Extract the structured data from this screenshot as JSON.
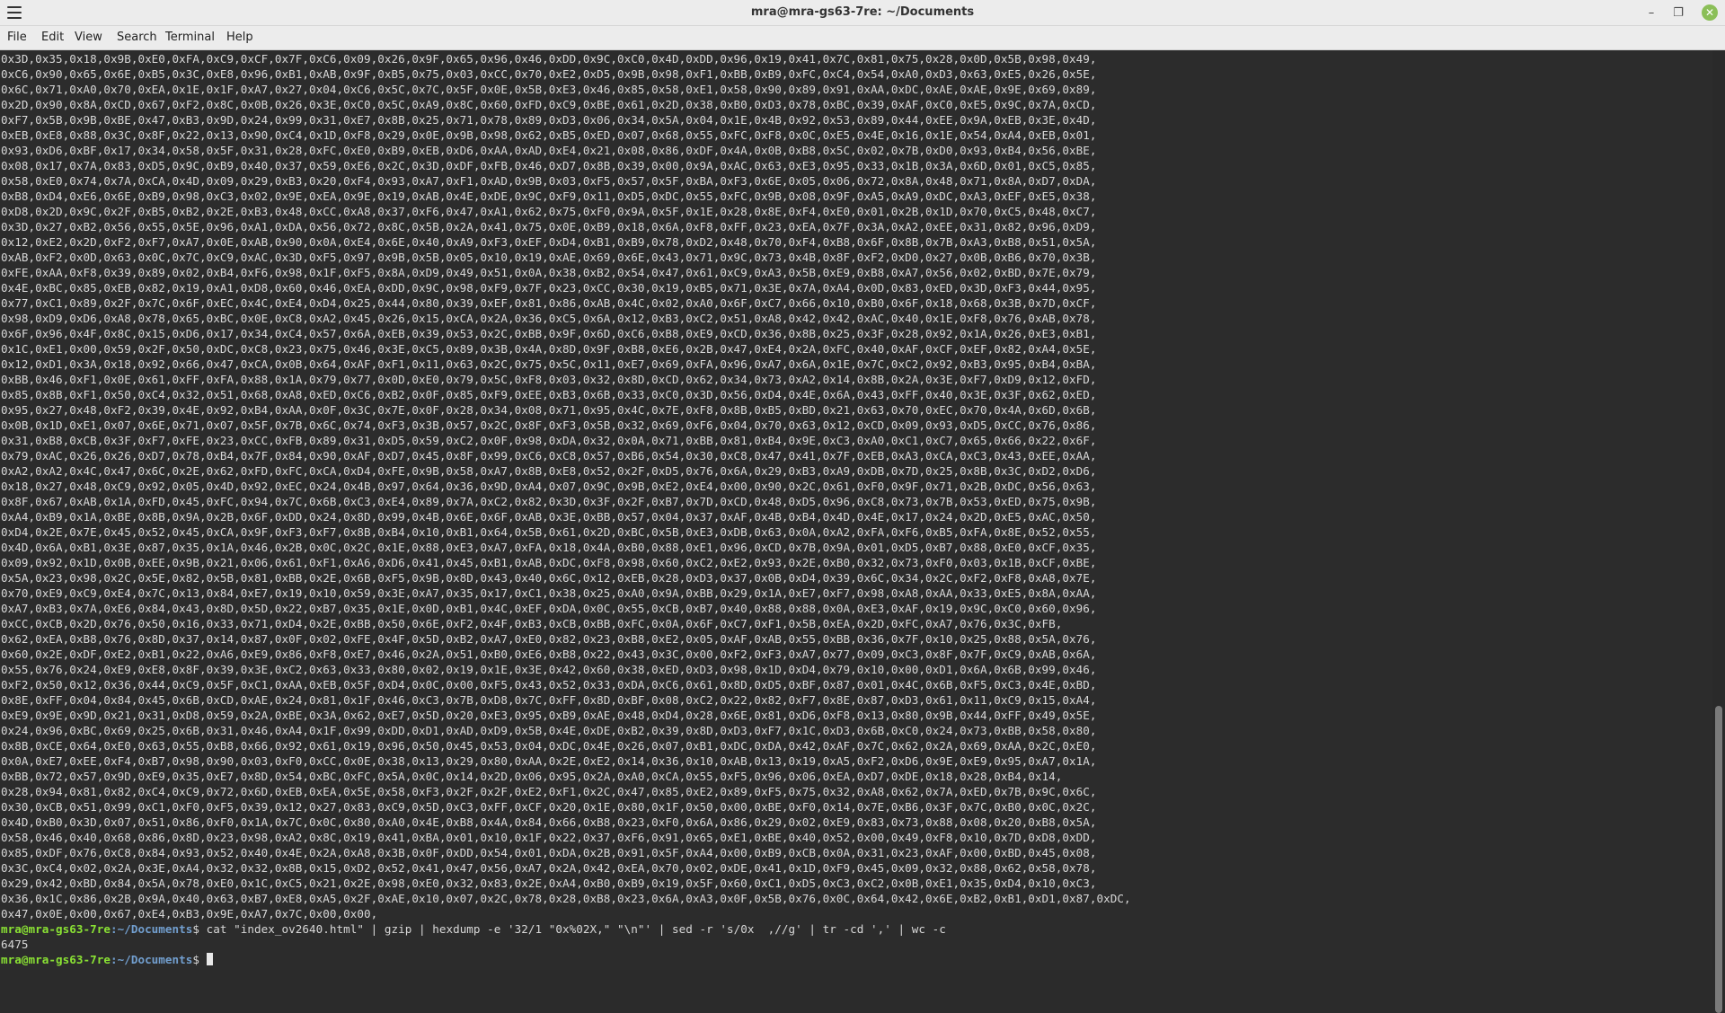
{
  "window": {
    "title": "mra@mra-gs63-7re: ~/Documents"
  },
  "menubar": {
    "file": "File",
    "edit": "Edit",
    "view": "View",
    "search": "Search",
    "terminal": "Terminal",
    "help": "Help"
  },
  "terminal": {
    "hex_lines": [
      "0x3D,0x35,0x18,0x9B,0xE0,0xFA,0xC9,0xCF,0x7F,0xC6,0x09,0x26,0x9F,0x65,0x96,0x46,0xDD,0x9C,0xC0,0x4D,0xDD,0x96,0x19,0x41,0x7C,0x81,0x75,0x28,0x0D,0x5B,0x98,0x49,",
      "0xC6,0x90,0x65,0x6E,0xB5,0x3C,0xE8,0x96,0xB1,0xAB,0x9F,0xB5,0x75,0x03,0xCC,0x70,0xE2,0xD5,0x9B,0x98,0xF1,0xBB,0xB9,0xFC,0xC4,0x54,0xA0,0xD3,0x63,0xE5,0x26,0x5E,",
      "0x6C,0x71,0xA0,0x70,0xEA,0x1E,0x1F,0xA7,0x27,0x04,0xC6,0x5C,0x7C,0x5F,0x0E,0x5B,0xE3,0x46,0x85,0x58,0xE1,0x58,0x90,0x89,0x91,0xAA,0xDC,0xAE,0xAE,0x9E,0x69,0x89,",
      "0x2D,0x90,0x8A,0xCD,0x67,0xF2,0x8C,0x0B,0x26,0x3E,0xC0,0x5C,0xA9,0x8C,0x60,0xFD,0xC9,0xBE,0x61,0x2D,0x38,0xB0,0xD3,0x78,0xBC,0x39,0xAF,0xC0,0xE5,0x9C,0x7A,0xCD,",
      "0xF7,0x5B,0x9B,0xBE,0x47,0xB3,0x9D,0x24,0x99,0x31,0xE7,0x8B,0x25,0x71,0x78,0x89,0xD3,0x06,0x34,0x5A,0x04,0x1E,0x4B,0x92,0x53,0x89,0x44,0xEE,0x9A,0xEB,0x3E,0x4D,",
      "0xEB,0xE8,0x88,0x3C,0x8F,0x22,0x13,0x90,0xC4,0x1D,0xF8,0x29,0x0E,0x9B,0x98,0x62,0xB5,0xED,0x07,0x68,0x55,0xFC,0xF8,0x0C,0xE5,0x4E,0x16,0x1E,0x54,0xA4,0xEB,0x01,",
      "0x93,0xD6,0xBF,0x17,0x34,0x58,0x5F,0x31,0x28,0xFC,0xE0,0xB9,0xEB,0xD6,0xAA,0xAD,0xE4,0x21,0x08,0x86,0xDF,0x4A,0x0B,0xB8,0x5C,0x02,0x7B,0xD0,0x93,0xB4,0x56,0xBE,",
      "0x08,0x17,0x7A,0x83,0xD5,0x9C,0xB9,0x40,0x37,0x59,0xE6,0x2C,0x3D,0xDF,0xFB,0x46,0xD7,0x8B,0x39,0x00,0x9A,0xAC,0x63,0xE3,0x95,0x33,0x1B,0x3A,0x6D,0x01,0xC5,0x85,",
      "0x58,0xE0,0x74,0x7A,0xCA,0x4D,0x09,0x29,0xB3,0x20,0xF4,0x93,0xA7,0xF1,0xAD,0x9B,0x03,0xF5,0x57,0x5F,0xBA,0xF3,0x6E,0x05,0x06,0x72,0x8A,0x48,0x71,0x8A,0xD7,0xDA,",
      "0xB8,0xD4,0xE6,0x6E,0xB9,0x98,0xC3,0x02,0x9E,0xEA,0x9E,0x19,0xAB,0x4E,0xDE,0x9C,0xF9,0x11,0xD5,0xDC,0x55,0xFC,0x9B,0x08,0x9F,0xA5,0xA9,0xDC,0xA3,0xEF,0xE5,0x38,",
      "0xD8,0x2D,0x9C,0x2F,0xB5,0xB2,0x2E,0xB3,0x48,0xCC,0xA8,0x37,0xF6,0x47,0xA1,0x62,0x75,0xF0,0x9A,0x5F,0x1E,0x28,0x8E,0xF4,0xE0,0x01,0x2B,0x1D,0x70,0xC5,0x48,0xC7,",
      "0x3D,0x27,0xB2,0x56,0x55,0x5E,0x96,0xA1,0xDA,0x56,0x72,0x8C,0x5B,0x2A,0x41,0x75,0x0E,0xB9,0x18,0x6A,0xF8,0xFF,0x23,0xEA,0x7F,0x3A,0xA2,0xEE,0x31,0x82,0x96,0xD9,",
      "0x12,0xE2,0x2D,0xF2,0xF7,0xA7,0x0E,0xAB,0x90,0x0A,0xE4,0x6E,0x40,0xA9,0xF3,0xEF,0xD4,0xB1,0xB9,0x78,0xD2,0x48,0x70,0xF4,0xB8,0x6F,0x8B,0x7B,0xA3,0xB8,0x51,0x5A,",
      "0xAB,0xF2,0x0D,0x63,0x0C,0x7C,0xC9,0xAC,0x3D,0xF5,0x97,0x9B,0x5B,0x05,0x10,0x19,0xAE,0x69,0x6E,0x43,0x71,0x9C,0x73,0x4B,0x8F,0xF2,0xD0,0x27,0x0B,0xB6,0x70,0x3B,",
      "0xFE,0xAA,0xF8,0x39,0x89,0x02,0xB4,0xF6,0x98,0x1F,0xF5,0x8A,0xD9,0x49,0x51,0x0A,0x38,0xB2,0x54,0x47,0x61,0xC9,0xA3,0x5B,0xE9,0xB8,0xA7,0x56,0x02,0xBD,0x7E,0x79,",
      "0x4E,0xBC,0x85,0xEB,0x82,0x19,0xA1,0xD8,0x60,0x46,0xEA,0xDD,0x9C,0x98,0xF9,0x7F,0x23,0xCC,0x30,0x19,0xB5,0x71,0x3E,0x7A,0xA4,0x0D,0x83,0xED,0x3D,0xF3,0x44,0x95,",
      "0x77,0xC1,0x89,0x2F,0x7C,0x6F,0xEC,0x4C,0xE4,0xD4,0x25,0x44,0x80,0x39,0xEF,0x81,0x86,0xAB,0x4C,0x02,0xA0,0x6F,0xC7,0x66,0x10,0xB0,0x6F,0x18,0x68,0x3B,0x7D,0xCF,",
      "0x98,0xD9,0xD6,0xA8,0x78,0x65,0xBC,0x0E,0xC8,0xA2,0x45,0x26,0x15,0xCA,0x2A,0x36,0xC5,0x6A,0x12,0xB3,0xC2,0x51,0xA8,0x42,0x42,0xAC,0x40,0x1E,0xF8,0x76,0xAB,0x78,",
      "0x6F,0x96,0x4F,0x8C,0x15,0xD6,0x17,0x34,0xC4,0x57,0x6A,0xEB,0x39,0x53,0x2C,0xBB,0x9F,0x6D,0xC6,0xB8,0xE9,0xCD,0x36,0x8B,0x25,0x3F,0x28,0x92,0x1A,0x26,0xE3,0xB1,",
      "0x1C,0xE1,0x00,0x59,0x2F,0x50,0xDC,0xC8,0x23,0x75,0x46,0x3E,0xC5,0x89,0x3B,0x4A,0x8D,0x9F,0xB8,0xE6,0x2B,0x47,0xE4,0x2A,0xFC,0x40,0xAF,0xCF,0xEF,0x82,0xA4,0x5E,",
      "0x12,0xD1,0x3A,0x18,0x92,0x66,0x47,0xCA,0x0B,0x64,0xAF,0xF1,0x11,0x63,0x2C,0x75,0x5C,0x11,0xE7,0x69,0xFA,0x96,0xA7,0x6A,0x1E,0x7C,0xC2,0x92,0xB3,0x95,0xB4,0xBA,",
      "0xBB,0x46,0xF1,0x0E,0x61,0xFF,0xFA,0x88,0x1A,0x79,0x77,0x0D,0xE0,0x79,0x5C,0xF8,0x03,0x32,0x8D,0xCD,0x62,0x34,0x73,0xA2,0x14,0x8B,0x2A,0x3E,0xF7,0xD9,0x12,0xFD,",
      "0x85,0x8B,0xF1,0x50,0xC4,0x32,0x51,0x68,0xA8,0xED,0xC6,0xB2,0x0F,0x85,0xF9,0xEE,0xB3,0x6B,0x33,0xC0,0x3D,0x56,0xD4,0x4E,0x6A,0x43,0xFF,0x40,0x3E,0x3F,0x62,0xED,",
      "0x95,0x27,0x48,0xF2,0x39,0x4E,0x92,0xB4,0xAA,0x0F,0x3C,0x7E,0x0F,0x28,0x34,0x08,0x71,0x95,0x4C,0x7E,0xF8,0x8B,0xB5,0xBD,0x21,0x63,0x70,0xEC,0x70,0x4A,0x6D,0x6B,",
      "0x0B,0x1D,0xE1,0x07,0x6E,0x71,0x07,0x5F,0x7B,0x6C,0x74,0xF3,0x3B,0x57,0x2C,0x8F,0xF3,0x5B,0x32,0x69,0xF6,0x04,0x70,0x63,0x12,0xCD,0x09,0x93,0xD5,0xCC,0x76,0x86,",
      "0x31,0xB8,0xCB,0x3F,0xF7,0xFE,0x23,0xCC,0xFB,0x89,0x31,0xD5,0x59,0xC2,0x0F,0x98,0xDA,0x32,0x0A,0x71,0xBB,0x81,0xB4,0x9E,0xC3,0xA0,0xC1,0xC7,0x65,0x66,0x22,0x6F,",
      "0x79,0xAC,0x26,0x26,0xD7,0x78,0xB4,0x7F,0x84,0x90,0xAF,0xD7,0x45,0x8F,0x99,0xC6,0xC8,0x57,0xB6,0x54,0x30,0xC8,0x47,0x41,0x7F,0xEB,0xA3,0xCA,0xC3,0x43,0xEE,0xAA,",
      "0xA2,0xA2,0x4C,0x47,0x6C,0x2E,0x62,0xFD,0xFC,0xCA,0xD4,0xFE,0x9B,0x58,0xA7,0x8B,0xE8,0x52,0x2F,0xD5,0x76,0x6A,0x29,0xB3,0xA9,0xDB,0x7D,0x25,0x8B,0x3C,0xD2,0xD6,",
      "0x18,0x27,0x48,0xC9,0x92,0x05,0x4D,0x92,0xEC,0x24,0x4B,0x97,0x64,0x36,0x9D,0xA4,0x07,0x9C,0x9B,0xE2,0xE4,0x00,0x90,0x2C,0x61,0xF0,0x9F,0x71,0x2B,0xDC,0x56,0x63,",
      "0x8F,0x67,0xAB,0x1A,0xFD,0x45,0xFC,0x94,0x7C,0x6B,0xC3,0xE4,0x89,0x7A,0xC2,0x82,0x3D,0x3F,0x2F,0xB7,0x7D,0xCD,0x48,0xD5,0x96,0xC8,0x73,0x7B,0x53,0xED,0x75,0x9B,",
      "0xA4,0xB9,0x1A,0xBE,0x8B,0x9A,0x2B,0x6F,0xDD,0x24,0x8D,0x99,0x4B,0x6E,0x6F,0xAB,0x3E,0xBB,0x57,0x04,0x37,0xAF,0x4B,0xB4,0x4D,0x4E,0x17,0x24,0x2D,0xE5,0xAC,0x50,",
      "0xD4,0x2E,0x7E,0x45,0x52,0x45,0xCA,0x9F,0xF3,0xF7,0x8B,0xB4,0x10,0xB1,0x64,0x5B,0x61,0x2D,0xBC,0x5B,0xE3,0xDB,0x63,0x0A,0xA2,0xFA,0xF6,0xB5,0xFA,0x8E,0x52,0x55,",
      "0x4D,0x6A,0xB1,0x3E,0x87,0x35,0x1A,0x46,0x2B,0x0C,0x2C,0x1E,0x88,0xE3,0xA7,0xFA,0x18,0x4A,0xB0,0x88,0xE1,0x96,0xCD,0x7B,0x9A,0x01,0xD5,0xB7,0x88,0xE0,0xCF,0x35,",
      "0x09,0x92,0x1D,0x0B,0xEE,0x9B,0x21,0x06,0x61,0xF1,0xA6,0xD6,0x41,0x45,0xB1,0xAB,0xDC,0xF8,0x98,0x60,0xC2,0xE2,0x93,0x2E,0xB0,0x32,0x73,0xF0,0x03,0x1B,0xCF,0xBE,",
      "0x5A,0x23,0x98,0x2C,0x5E,0x82,0x5B,0x81,0xBB,0x2E,0x6B,0xF5,0x9B,0x8D,0x43,0x40,0x6C,0x12,0xEB,0x28,0xD3,0x37,0x0B,0xD4,0x39,0x6C,0x34,0x2C,0xF2,0xF8,0xA8,0x7E,",
      "0x70,0xE9,0xC9,0xE4,0x7C,0x13,0x84,0xE7,0x19,0x10,0x59,0x3E,0xA7,0x35,0x17,0xC1,0x38,0x25,0xA0,0x9A,0xBB,0x29,0x1A,0xE7,0xF7,0x98,0xA8,0xAA,0x33,0xE5,0x8A,0xAA,",
      "0xA7,0xB3,0x7A,0xE6,0x84,0x43,0x8D,0x5D,0x22,0xB7,0x35,0x1E,0x0D,0xB1,0x4C,0xEF,0xDA,0x0C,0x55,0xCB,0xB7,0x40,0x88,0x88,0x0A,0xE3,0xAF,0x19,0x9C,0xC0,0x60,0x96,",
      "0xCC,0xCB,0x2D,0x76,0x50,0x16,0x33,0x71,0xD4,0x2E,0xBB,0x50,0x6E,0xF2,0x4F,0xB3,0xCB,0xBB,0xFC,0x0A,0x6F,0xC7,0xF1,0x5B,0xEA,0x2D,0xFC,0xA7,0x76,0x3C,0xFB,",
      "0x62,0xEA,0xB8,0x76,0x8D,0x37,0x14,0x87,0x0F,0x02,0xFE,0x4F,0x5D,0xB2,0xA7,0xE0,0x82,0x23,0xB8,0xE2,0x05,0xAF,0xAB,0x55,0xBB,0x36,0x7F,0x10,0x25,0x88,0x5A,0x76,",
      "0x60,0x2E,0xDF,0xE2,0xB1,0x22,0xA6,0xE9,0x86,0xF8,0xE7,0x46,0x2A,0x51,0xB0,0xE6,0xB8,0x22,0x43,0x3C,0x00,0xF2,0xF3,0xA7,0x77,0x09,0xC3,0x8F,0x7F,0xC9,0xAB,0x6A,",
      "0x55,0x76,0x24,0xE9,0xE8,0x8F,0x39,0x3E,0xC2,0x63,0x33,0x80,0x02,0x19,0x1E,0x3E,0x42,0x60,0x38,0xED,0xD3,0x98,0x1D,0xD4,0x79,0x10,0x00,0xD1,0x6A,0x6B,0x99,0x46,",
      "0xF2,0x50,0x12,0x36,0x44,0xC9,0x5F,0xC1,0xAA,0xEB,0x5F,0xD4,0x0C,0x00,0xF5,0x43,0x52,0x33,0xDA,0xC6,0x61,0x8D,0xD5,0xBF,0x87,0x01,0x4C,0x6B,0xF5,0xC3,0x4E,0xBD,",
      "0x8E,0xFF,0x04,0x84,0x45,0x6B,0xCD,0xAE,0x24,0x81,0x1F,0x46,0xC3,0x7B,0xD8,0x7C,0xFF,0x8D,0xBF,0x08,0xC2,0x22,0x82,0xF7,0x8E,0x87,0xD3,0x61,0x11,0xC9,0x15,0xA4,",
      "0xE9,0x9E,0x9D,0x21,0x31,0xD8,0x59,0x2A,0xBE,0x3A,0x62,0xE7,0x5D,0x20,0xE3,0x95,0xB9,0xAE,0x48,0xD4,0x28,0x6E,0x81,0xD6,0xF8,0x13,0x80,0x9B,0x44,0xFF,0x49,0x5E,",
      "0x24,0x96,0xBC,0x69,0x25,0x6B,0x31,0x46,0xA4,0x1F,0x99,0xDD,0xD1,0xAD,0xD9,0x5B,0x4E,0xDE,0xB2,0x39,0x8D,0xD3,0xF7,0x1C,0xD3,0x6B,0xC0,0x24,0x73,0xBB,0x58,0x80,",
      "0x8B,0xCE,0x64,0xE0,0x63,0x55,0xB8,0x66,0x92,0x61,0x19,0x96,0x50,0x45,0x53,0x04,0xDC,0x4E,0x26,0x07,0xB1,0xDC,0xDA,0x42,0xAF,0x7C,0x62,0x2A,0x69,0xAA,0x2C,0xE0,",
      "0x0A,0xE7,0xEE,0xF4,0xB7,0x98,0x90,0x03,0xF0,0xCC,0x0E,0x38,0x13,0x29,0x80,0xAA,0x2E,0xE2,0x14,0x36,0x10,0xAB,0x13,0x19,0xA5,0xF2,0xD6,0x9E,0xE9,0x95,0xA7,0x1A,",
      "0xBB,0x72,0x57,0x9D,0xE9,0x35,0xE7,0x8D,0x54,0xBC,0xFC,0x5A,0x0C,0x14,0x2D,0x06,0x95,0x2A,0xA0,0xCA,0x55,0xF5,0x96,0x06,0xEA,0xD7,0xDE,0x18,0x28,0xB4,0x14,",
      "0x28,0x94,0x81,0x82,0xC4,0xC9,0x72,0x6D,0xEB,0xEA,0x5E,0x58,0xF3,0x2F,0x2F,0xE2,0xF1,0x2C,0x47,0x85,0xE2,0x89,0xF5,0x75,0x32,0xA8,0x62,0x7A,0xED,0x7B,0x9C,0x6C,",
      "0x30,0xCB,0x51,0x99,0xC1,0xF0,0xF5,0x39,0x12,0x27,0x83,0xC9,0x5D,0xC3,0xFF,0xCF,0x20,0x1E,0x80,0x1F,0x50,0x00,0xBE,0xF0,0x14,0x7E,0xB6,0x3F,0x7C,0xB0,0x0C,0x2C,",
      "0x4D,0xB0,0x3D,0x07,0x51,0x86,0xF0,0x1A,0x7C,0x0C,0x80,0xA0,0x4E,0xB8,0x4A,0x84,0x66,0xB8,0x23,0xF0,0x6A,0x86,0x29,0x02,0xE9,0x83,0x73,0x88,0x08,0x20,0xB8,0x5A,",
      "0x58,0x46,0x40,0x68,0x86,0x8D,0x23,0x98,0xA2,0x8C,0x19,0x41,0xBA,0x01,0x10,0x1F,0x22,0x37,0xF6,0x91,0x65,0xE1,0xBE,0x40,0x52,0x00,0x49,0xF8,0x10,0x7D,0xD8,0xDD,",
      "0x85,0xDF,0x76,0xC8,0x84,0x93,0x52,0x40,0x4E,0x2A,0xA8,0x3B,0x0F,0xDD,0x54,0x01,0xDA,0x2B,0x91,0x5F,0xA4,0x00,0xB9,0xCB,0x0A,0x31,0x23,0xAF,0x00,0xBD,0x45,0x08,",
      "0x3C,0xC4,0x02,0x2A,0x3E,0xA4,0x32,0x32,0x8B,0x15,0xD2,0x52,0x41,0x47,0x56,0xA7,0x2A,0x42,0xEA,0x70,0x02,0xDE,0x41,0x1D,0xF9,0x45,0x09,0x32,0x88,0x62,0x58,0x78,",
      "0x29,0x42,0xBD,0x84,0x5A,0x78,0xE0,0x1C,0xC5,0x21,0x2E,0x98,0xE0,0x32,0x83,0x2E,0xA4,0xB0,0xB9,0x19,0x5F,0x60,0xC1,0xD5,0xC3,0xC2,0x0B,0xE1,0x35,0xD4,0x10,0xC3,",
      "0x36,0x1C,0x86,0x2B,0x9A,0x40,0x63,0xB7,0xE8,0xA5,0x2F,0xAE,0x10,0x07,0x2C,0x78,0x28,0xB8,0x23,0x6A,0xA3,0x0F,0x5B,0x76,0x0C,0x64,0x42,0x6E,0xB2,0xB1,0xD1,0x87,0xDC,",
      "0x47,0x0E,0x00,0x67,0xE4,0xB3,0x9E,0xA7,0x7C,0x00,0x00,"
    ],
    "command_prompt_user": "mra@mra-gs63-7re",
    "command_prompt_path": ":~/Documents",
    "command_prompt_sign": "$ ",
    "command_text": "cat \"index_ov2640.html\" | gzip | hexdump -e '32/1 \"0x%02X,\" \"\\n\"' | sed -r 's/0x  ,//g' | tr -cd ',' | wc -c",
    "output_count": "6475",
    "current_prompt_user": "mra@mra-gs63-7re",
    "current_prompt_path": ":~/Documents",
    "current_prompt_sign": "$ "
  }
}
